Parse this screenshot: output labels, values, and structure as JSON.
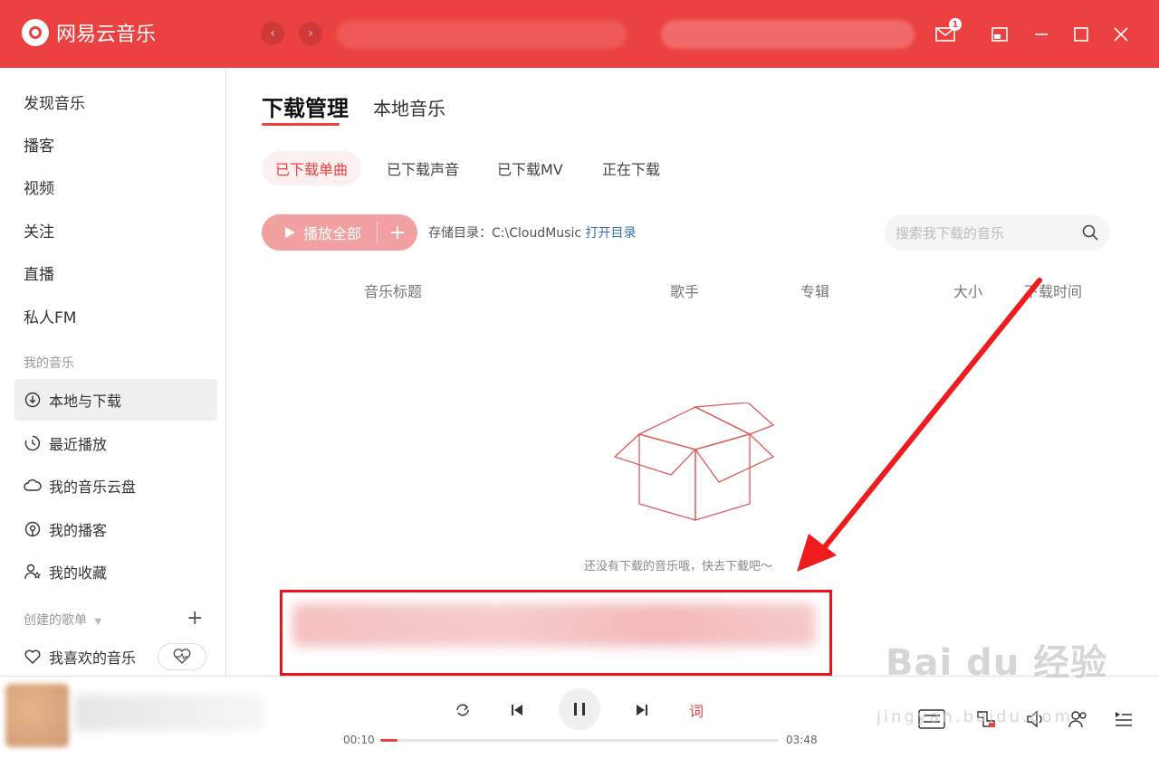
{
  "app": {
    "title": "网易云音乐",
    "brand_color": "#ec4141"
  },
  "titlebar": {
    "mail_badge": "1"
  },
  "sidebar": {
    "items": [
      {
        "label": "发现音乐"
      },
      {
        "label": "播客"
      },
      {
        "label": "视频"
      },
      {
        "label": "关注"
      },
      {
        "label": "直播"
      },
      {
        "label": "私人FM"
      }
    ],
    "my_music_title": "我的音乐",
    "my_music": [
      {
        "label": "本地与下载",
        "icon": "download-icon",
        "active": true
      },
      {
        "label": "最近播放",
        "icon": "history-icon"
      },
      {
        "label": "我的音乐云盘",
        "icon": "cloud-icon"
      },
      {
        "label": "我的播客",
        "icon": "podcast-icon"
      },
      {
        "label": "我的收藏",
        "icon": "user-star-icon"
      }
    ],
    "created_title": "创建的歌单",
    "created_add": "+",
    "liked": {
      "label": "我喜欢的音乐",
      "icon": "heart-icon"
    }
  },
  "main": {
    "tabs": [
      {
        "label": "下载管理",
        "active": true
      },
      {
        "label": "本地音乐"
      }
    ],
    "subtabs": [
      {
        "label": "已下载单曲",
        "active": true
      },
      {
        "label": "已下载声音"
      },
      {
        "label": "已下载MV"
      },
      {
        "label": "正在下载"
      }
    ],
    "play_all": "播放全部",
    "play_add": "+",
    "storage_label": "存储目录：C:\\CloudMusic",
    "open_dir": "打开目录",
    "search_placeholder": "搜索我下载的音乐",
    "columns": [
      "音乐标题",
      "歌手",
      "专辑",
      "大小",
      "下载时间"
    ],
    "empty_text": "还没有下载的音乐哦，快去下载吧～"
  },
  "player": {
    "current_time": "00:10",
    "total_time": "03:48",
    "progress": 0.044,
    "lyric_label": "词"
  },
  "watermark": {
    "text": "Bai du 经验",
    "sub": "jingyan.baidu.com"
  }
}
